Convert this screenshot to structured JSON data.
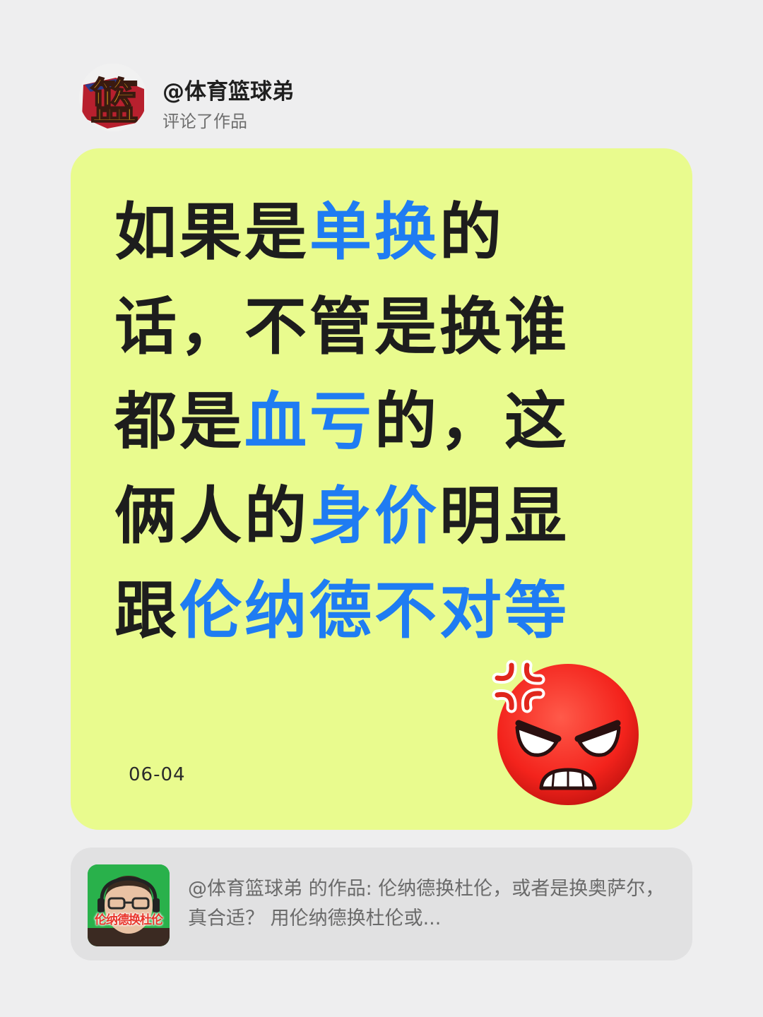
{
  "header": {
    "user_name": "@体育篮球弟",
    "action": "评论了作品",
    "avatar_glyph": "篮"
  },
  "comment": {
    "lines": [
      [
        {
          "t": "如果是",
          "hl": false
        },
        {
          "t": "单换",
          "hl": true
        },
        {
          "t": "的",
          "hl": false
        }
      ],
      [
        {
          "t": "话，不管是换谁",
          "hl": false
        }
      ],
      [
        {
          "t": "都是",
          "hl": false
        },
        {
          "t": "血亏",
          "hl": true
        },
        {
          "t": "的，这",
          "hl": false
        }
      ],
      [
        {
          "t": "俩人的",
          "hl": false
        },
        {
          "t": "身价",
          "hl": true
        },
        {
          "t": "明显",
          "hl": false
        }
      ],
      [
        {
          "t": "跟",
          "hl": false
        },
        {
          "t": "伦纳德不对等",
          "hl": true
        }
      ]
    ],
    "date": "06-04",
    "emoji": "angry-face"
  },
  "quote": {
    "thumb_caption": "伦纳德换杜伦",
    "text": "@体育篮球弟  的作品: 伦纳德换杜伦，或者是换奥萨尔，真合适？ 用伦纳德换杜伦或..."
  },
  "colors": {
    "page_bg": "#eeeeef",
    "card_bg": "#e9fb8e",
    "highlight": "#1f7cf2",
    "text": "#1d1d1d",
    "quote_bg": "#e1e1e2"
  }
}
